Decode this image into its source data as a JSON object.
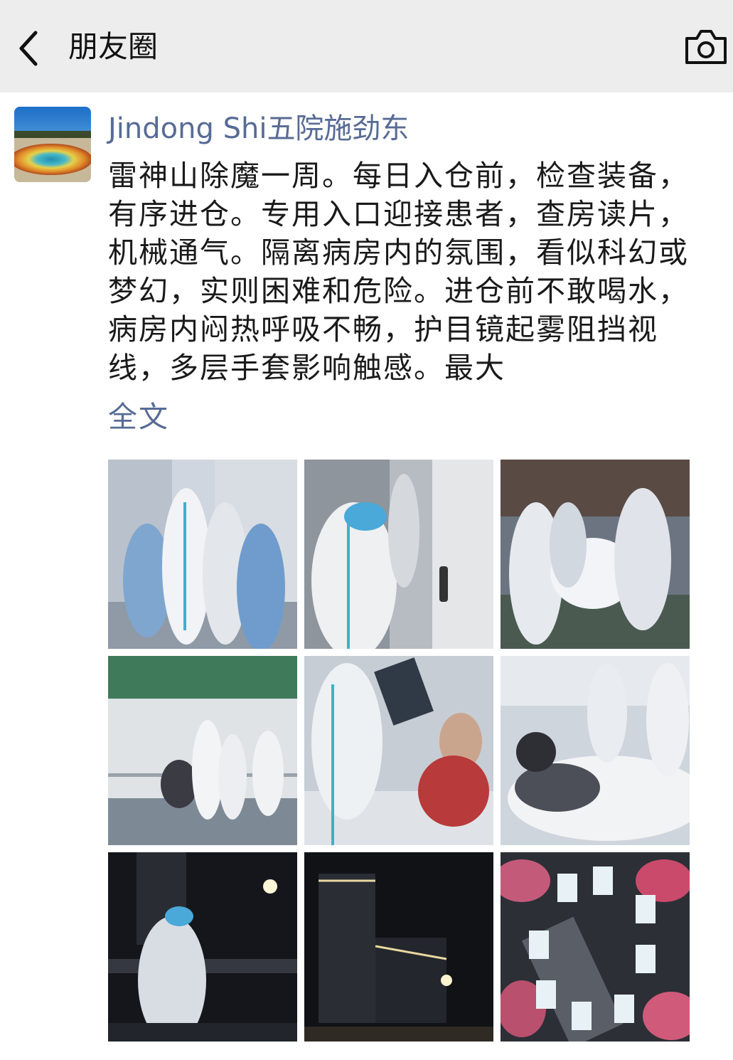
{
  "header": {
    "title": "朋友圈",
    "back_icon": "chevron-left-icon",
    "camera_icon": "camera-icon",
    "background": "#ededed"
  },
  "post": {
    "author": "Jindong Shi五院施劲东",
    "text": "雷神山除魔一周。每日入仓前，检查装备，有序进仓。专用入口迎接患者，查房读片，机械通气。隔离病房内的氛围，看似科幻或梦幻，实则困难和危险。进仓前不敢喝水，病房内闷热呼吸不畅，护目镜起雾阻挡视线，多层手套影响触感。最大",
    "expand_label": "全文",
    "link_color": "#576b95",
    "images": [
      {
        "scene": "staff-donning-gowns"
      },
      {
        "scene": "staff-at-ward-door"
      },
      {
        "scene": "moving-patient-outdoors"
      },
      {
        "scene": "wheelchair-at-entrance"
      },
      {
        "scene": "reading-xray-in-ward"
      },
      {
        "scene": "patient-in-bed"
      },
      {
        "scene": "staff-at-night"
      },
      {
        "scene": "buildings-at-night"
      },
      {
        "scene": "hands-holding-badges"
      }
    ]
  }
}
